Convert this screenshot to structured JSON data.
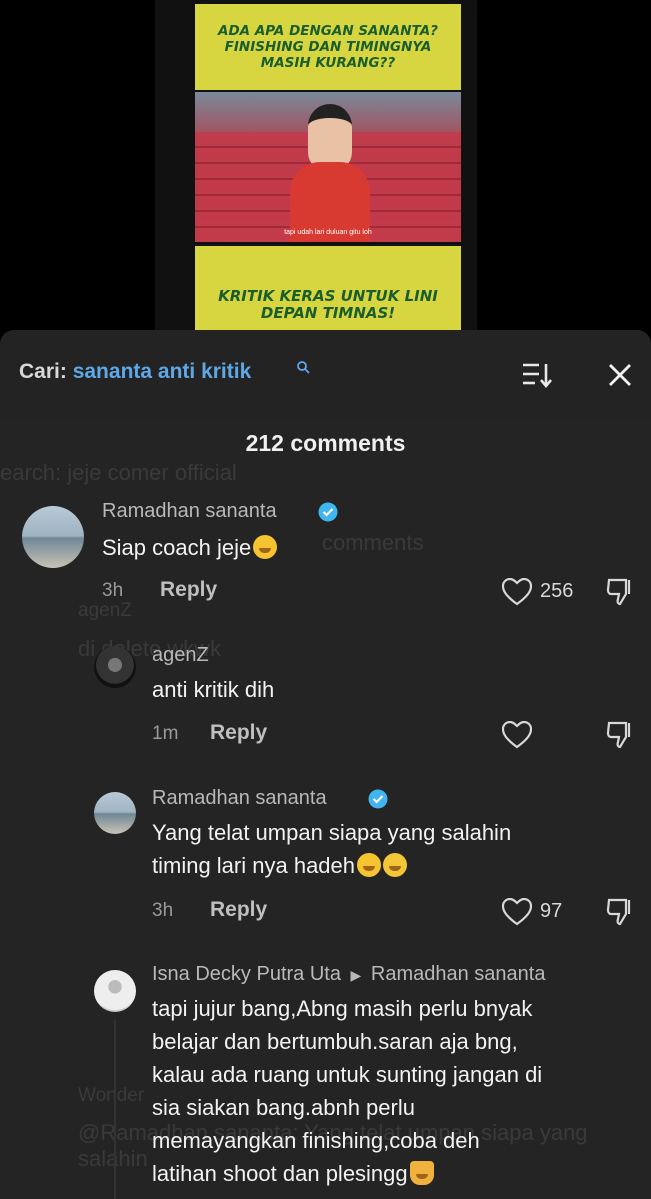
{
  "video": {
    "banner_top": "ADA APA DENGAN SANANTA? FINISHING DAN TIMINGNYA MASIH KURANG??",
    "subtitle": "tapi udah lari duluan gitu loh",
    "banner_bottom": "KRITIK KERAS UNTUK LINI DEPAN TIMNAS!"
  },
  "search": {
    "prefix": "Cari:",
    "query": "sananta anti kritik",
    "search_icon": "search-icon",
    "sort_icon": "sort-icon",
    "close_icon": "close-icon"
  },
  "comments_count": "212 comments",
  "background_ghost": {
    "search": "earch: jeje comer official",
    "count": "comments",
    "user": "agenZ",
    "text": "di delete wkwk",
    "user2": "Wonder",
    "text2": "@Ramadhan sananta: Yang telat umpan siapa yang salahin"
  },
  "comments": [
    {
      "username": "Ramadhan sananta",
      "verified": true,
      "text": "Siap coach jeje",
      "emoji": [
        "smile"
      ],
      "time": "3h",
      "reply": "Reply",
      "likes": "256"
    },
    {
      "username": "agenZ",
      "verified": false,
      "text": "anti kritik dih",
      "time": "1m",
      "reply": "Reply",
      "likes": ""
    },
    {
      "username": "Ramadhan sananta",
      "verified": true,
      "text_lines": [
        "Yang telat umpan siapa yang salahin",
        "timing lari nya hadeh"
      ],
      "emoji": [
        "smile",
        "laugh"
      ],
      "time": "3h",
      "reply": "Reply",
      "likes": "97"
    },
    {
      "username": "Isna Decky Putra Uta",
      "reply_to": "Ramadhan sananta",
      "verified": false,
      "text_lines": [
        "tapi jujur bang,Abng masih perlu bnyak",
        "belajar dan bertumbuh.saran aja bng,",
        "kalau ada ruang untuk sunting jangan di",
        "sia siakan bang.abnh perlu",
        "memayangkan finishing,coba deh",
        "latihan shoot dan plesingg"
      ],
      "emoji": [
        "pray"
      ]
    }
  ],
  "colors": {
    "background": "#000000",
    "sheet": "#242424",
    "link_blue": "#5fa8e8",
    "verified_blue": "#3fb6f0",
    "banner_yellow": "#d8d640",
    "banner_green": "#1a5e2e"
  }
}
